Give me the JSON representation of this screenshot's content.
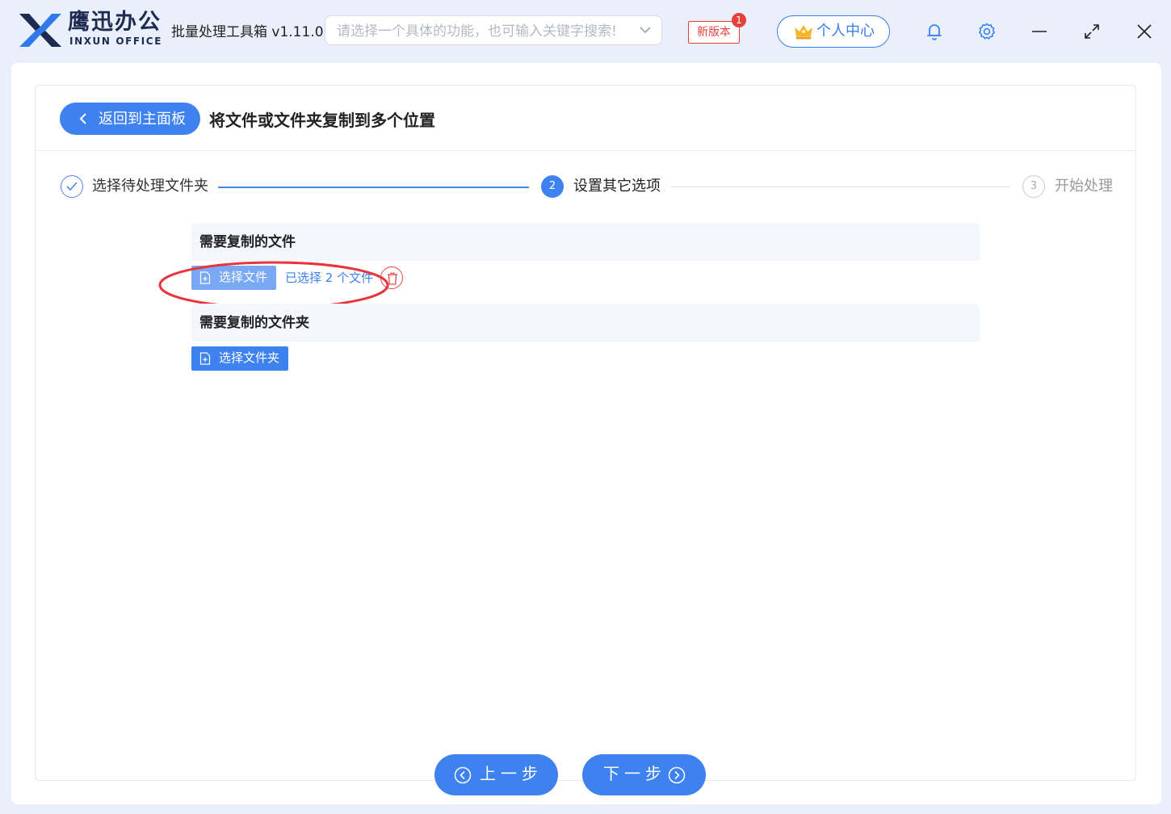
{
  "app": {
    "brand_cn": "鹰迅办公",
    "brand_en": "INXUN OFFICE",
    "title": "批量处理工具箱 v1.11.0",
    "accent_color": "#3e82f0"
  },
  "search": {
    "placeholder": "请选择一个具体的功能，也可输入关键字搜索!",
    "value": ""
  },
  "header": {
    "new_version_label": "新版本",
    "new_version_badge": "1",
    "user_center_label": "个人中心",
    "icons": [
      "crown-icon",
      "bell-icon",
      "gear-icon",
      "minimize-icon",
      "maximize-icon",
      "close-icon"
    ]
  },
  "page": {
    "back_label": "返回到主面板",
    "title": "将文件或文件夹复制到多个位置"
  },
  "steps": [
    {
      "number": "",
      "label": "选择待处理文件夹",
      "state": "done"
    },
    {
      "number": "2",
      "label": "设置其它选项",
      "state": "active"
    },
    {
      "number": "3",
      "label": "开始处理",
      "state": "pending"
    }
  ],
  "files_section": {
    "title": "需要复制的文件",
    "button_label": "选择文件",
    "selected_text": "已选择 2 个文件"
  },
  "folders_section": {
    "title": "需要复制的文件夹",
    "button_label": "选择文件夹"
  },
  "footer": {
    "prev_label": "上一步",
    "next_label": "下一步"
  }
}
